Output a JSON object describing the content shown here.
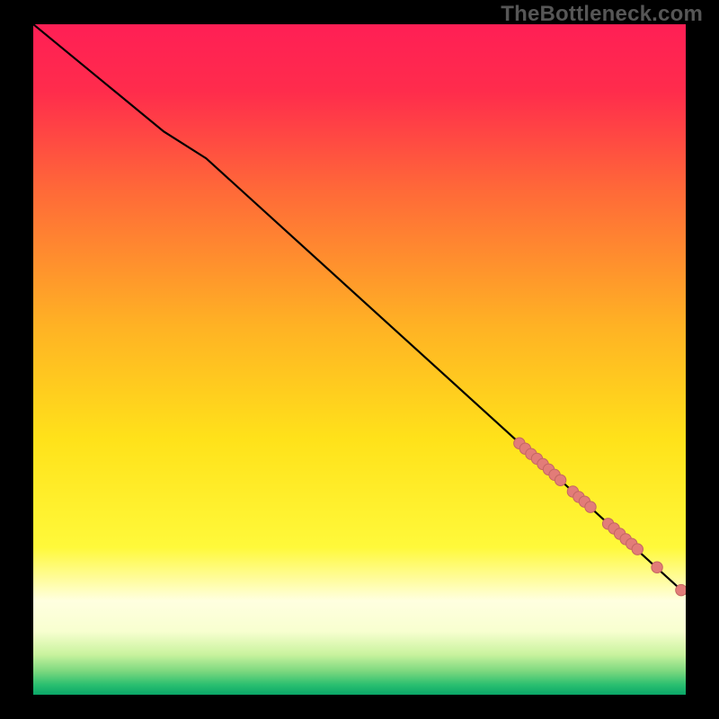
{
  "watermark": "TheBottleneck.com",
  "colors": {
    "bg": "#000000",
    "watermark": "#565656",
    "curve": "#000000",
    "dot_fill": "#e27c78",
    "dot_stroke": "#c46662",
    "gradient_stops": [
      {
        "offset": 0,
        "color": "#ff1f55"
      },
      {
        "offset": 0.1,
        "color": "#ff2c4c"
      },
      {
        "offset": 0.25,
        "color": "#ff6a38"
      },
      {
        "offset": 0.45,
        "color": "#ffb224"
      },
      {
        "offset": 0.62,
        "color": "#ffe21a"
      },
      {
        "offset": 0.78,
        "color": "#fff93a"
      },
      {
        "offset": 0.86,
        "color": "#ffffe0"
      },
      {
        "offset": 0.905,
        "color": "#f8ffd0"
      },
      {
        "offset": 0.94,
        "color": "#c9f39e"
      },
      {
        "offset": 0.965,
        "color": "#7cd87f"
      },
      {
        "offset": 0.985,
        "color": "#2bbf70"
      },
      {
        "offset": 1.0,
        "color": "#0aa768"
      }
    ]
  },
  "chart_data": {
    "type": "line",
    "title": "",
    "xlabel": "",
    "ylabel": "",
    "xlim": [
      0,
      100
    ],
    "ylim": [
      0,
      100
    ],
    "series": [
      {
        "name": "curve",
        "x": [
          0,
          10,
          20,
          26.5,
          100
        ],
        "y": [
          100,
          92,
          84,
          80,
          15
        ],
        "style": "line"
      },
      {
        "name": "dots",
        "x": [
          74.5,
          75.4,
          76.3,
          77.2,
          78.1,
          79.0,
          79.9,
          80.8,
          82.7,
          83.6,
          84.5,
          85.4,
          88.1,
          89.0,
          89.9,
          90.8,
          91.7,
          92.6,
          95.6,
          99.3
        ],
        "y": [
          37.5,
          36.7,
          35.9,
          35.2,
          34.4,
          33.6,
          32.8,
          32.0,
          30.3,
          29.5,
          28.8,
          28.0,
          25.5,
          24.8,
          24.0,
          23.2,
          22.5,
          21.7,
          19.0,
          15.6
        ],
        "style": "scatter"
      }
    ]
  }
}
